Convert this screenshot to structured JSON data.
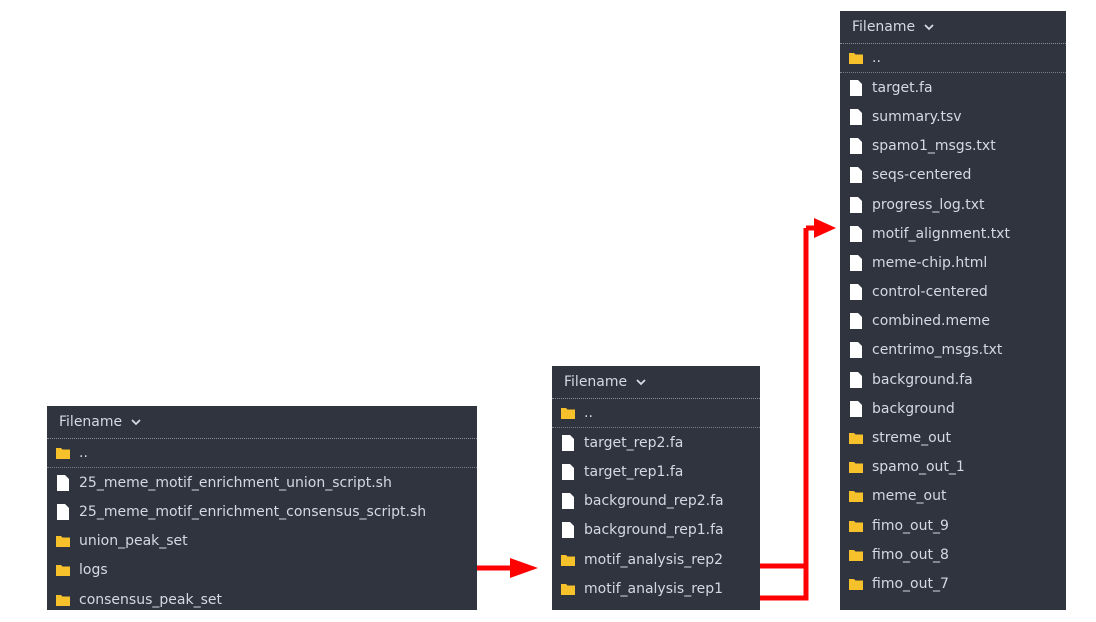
{
  "panels": [
    {
      "header": "Filename",
      "items": [
        {
          "type": "folder",
          "name": ".."
        },
        {
          "type": "file",
          "name": "25_meme_motif_enrichment_union_script.sh"
        },
        {
          "type": "file",
          "name": "25_meme_motif_enrichment_consensus_script.sh"
        },
        {
          "type": "folder",
          "name": "union_peak_set"
        },
        {
          "type": "folder",
          "name": "logs"
        },
        {
          "type": "folder",
          "name": "consensus_peak_set"
        }
      ]
    },
    {
      "header": "Filename",
      "items": [
        {
          "type": "folder",
          "name": ".."
        },
        {
          "type": "file",
          "name": "target_rep2.fa"
        },
        {
          "type": "file",
          "name": "target_rep1.fa"
        },
        {
          "type": "file",
          "name": "background_rep2.fa"
        },
        {
          "type": "file",
          "name": "background_rep1.fa"
        },
        {
          "type": "folder",
          "name": "motif_analysis_rep2"
        },
        {
          "type": "folder",
          "name": "motif_analysis_rep1"
        }
      ]
    },
    {
      "header": "Filename",
      "items": [
        {
          "type": "folder",
          "name": ".."
        },
        {
          "type": "file",
          "name": "target.fa"
        },
        {
          "type": "file",
          "name": "summary.tsv"
        },
        {
          "type": "file",
          "name": "spamo1_msgs.txt"
        },
        {
          "type": "file",
          "name": "seqs-centered"
        },
        {
          "type": "file",
          "name": "progress_log.txt"
        },
        {
          "type": "file",
          "name": "motif_alignment.txt"
        },
        {
          "type": "file",
          "name": "meme-chip.html"
        },
        {
          "type": "file",
          "name": "control-centered"
        },
        {
          "type": "file",
          "name": "combined.meme"
        },
        {
          "type": "file",
          "name": "centrimo_msgs.txt"
        },
        {
          "type": "file",
          "name": "background.fa"
        },
        {
          "type": "file",
          "name": "background"
        },
        {
          "type": "folder",
          "name": "streme_out"
        },
        {
          "type": "folder",
          "name": "spamo_out_1"
        },
        {
          "type": "folder",
          "name": "meme_out"
        },
        {
          "type": "folder",
          "name": "fimo_out_9"
        },
        {
          "type": "folder",
          "name": "fimo_out_8"
        },
        {
          "type": "folder",
          "name": "fimo_out_7"
        }
      ]
    }
  ],
  "colors": {
    "panel_bg": "#2f343f",
    "text": "#d3dae3",
    "folder": "#f6c12a",
    "file": "#ffffff",
    "arrow": "#ff0000"
  },
  "icons": {
    "folder": "folder-icon",
    "file": "file-icon",
    "sort": "chevron-down-icon"
  }
}
